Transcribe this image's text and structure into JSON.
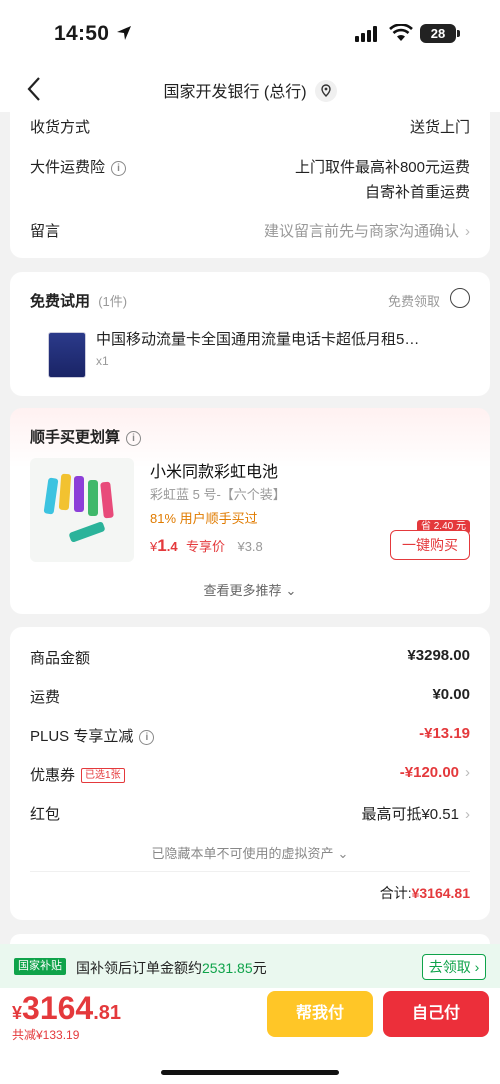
{
  "status": {
    "time": "14:50",
    "battery": "28"
  },
  "nav": {
    "title": "国家开发银行 (总行)"
  },
  "delivery": {
    "method_label": "收货方式",
    "method_value": "送货上门",
    "insurance_label": "大件运费险",
    "insurance_line1": "上门取件最高补800元运费",
    "insurance_line2": "自寄补首重运费",
    "note_label": "留言",
    "note_placeholder": "建议留言前先与商家沟通确认"
  },
  "free_trial": {
    "title": "免费试用",
    "count": "(1件)",
    "claim_label": "免费领取",
    "item_name": "中国移动流量卡全国通用流量电话卡超低月租5…",
    "item_qty": "x1"
  },
  "addon": {
    "title": "顺手买更划算",
    "name": "小米同款彩虹电池",
    "spec": "彩虹蓝 5 号-【六个装】",
    "social": "81% 用户顺手买过",
    "price_sym": "¥",
    "price_int": "1",
    "price_dec": ".4",
    "price_tag": "专享价",
    "orig_price": "¥3.8",
    "save_tag": "省 2.40 元",
    "buy_label": "一键购买",
    "more": "查看更多推荐"
  },
  "summary": {
    "goods_label": "商品金额",
    "goods_value": "¥3298.00",
    "ship_label": "运费",
    "ship_value": "¥0.00",
    "plus_label": "PLUS 专享立减",
    "plus_value": "-¥13.19",
    "coupon_label": "优惠券",
    "coupon_tag": "已选1张",
    "coupon_value": "-¥120.00",
    "redpack_label": "红包",
    "redpack_value": "最高可抵¥0.51",
    "hidden_note": "已隐藏本单不可使用的虚拟资产",
    "total_label": "合计:",
    "total_value": "¥3164.81"
  },
  "subsidy": {
    "tag": "国家补贴",
    "text": "国补领后订单金额约",
    "amount": "2531.85",
    "unit": "元",
    "claim": "去领取"
  },
  "bottom": {
    "sym": "¥",
    "int": "3164",
    "dec": ".81",
    "saved": "共减¥133.19",
    "help_pay": "帮我付",
    "self_pay": "自己付"
  },
  "colors": {
    "accent_red": "#e4393c",
    "green": "#0fa34a",
    "yellow": "#ffc627"
  }
}
